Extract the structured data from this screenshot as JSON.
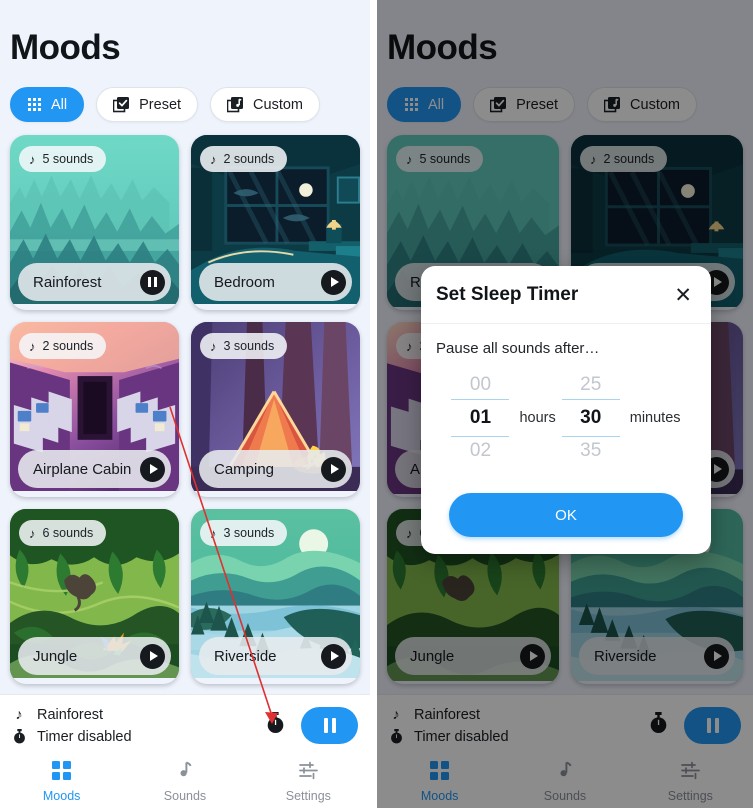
{
  "app": {
    "page_title": "Moods",
    "accent_color": "#2196f3",
    "background_color": "#eff3fb"
  },
  "filters": [
    {
      "label": "All",
      "icon": "grid-icon",
      "active": true
    },
    {
      "label": "Preset",
      "icon": "checkbox-square-icon",
      "active": false
    },
    {
      "label": "Custom",
      "icon": "music-square-icon",
      "active": false
    }
  ],
  "moods": [
    {
      "name": "Rainforest",
      "sounds_label": "5 sounds",
      "state": "pause",
      "art": "rainforest"
    },
    {
      "name": "Bedroom",
      "sounds_label": "2 sounds",
      "state": "play",
      "art": "bedroom"
    },
    {
      "name": "Airplane Cabin",
      "sounds_label": "2 sounds",
      "state": "play",
      "art": "airplane"
    },
    {
      "name": "Camping",
      "sounds_label": "3 sounds",
      "state": "play",
      "art": "camping"
    },
    {
      "name": "Jungle",
      "sounds_label": "6 sounds",
      "state": "play",
      "art": "jungle"
    },
    {
      "name": "Riverside",
      "sounds_label": "3 sounds",
      "state": "play",
      "art": "riverside"
    }
  ],
  "now_playing": {
    "track": "Rainforest",
    "timer_status": "Timer disabled",
    "track_icon": "music-note-icon",
    "timer_icon": "stopwatch-icon",
    "timer_button_icon": "stopwatch-icon",
    "transport_icon": "pause-icon"
  },
  "tabs": [
    {
      "label": "Moods",
      "icon": "grid-squares-icon",
      "active": true
    },
    {
      "label": "Sounds",
      "icon": "music-note-icon",
      "active": false
    },
    {
      "label": "Settings",
      "icon": "sliders-icon",
      "active": false
    }
  ],
  "dialog": {
    "title": "Set Sleep Timer",
    "close_icon": "close-icon",
    "subtitle": "Pause all sounds after…",
    "hours": {
      "above": "00",
      "value": "01",
      "below": "02",
      "label": "hours"
    },
    "minutes": {
      "above": "25",
      "value": "30",
      "below": "35",
      "label": "minutes"
    },
    "confirm_label": "OK"
  },
  "annotation": {
    "color": "#e03030",
    "target_icon": "stopwatch-icon"
  }
}
